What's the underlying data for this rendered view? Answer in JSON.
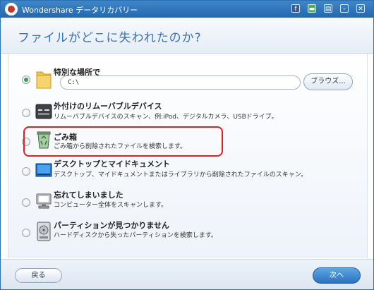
{
  "window": {
    "app_title": "Wondershare データリカバリー",
    "titlebar_icons": [
      "facebook-icon",
      "feedback-icon",
      "settings-icon",
      "minimize-icon",
      "close-icon"
    ]
  },
  "header": {
    "title": "ファイルがどこに失われたのか?"
  },
  "options": [
    {
      "title": "特別な場所で",
      "checked": true,
      "icon": "folder-icon",
      "path_value": "C:\\",
      "browse_label": "ブラウズ..."
    },
    {
      "title": "外付けのリムーバブルデバイス",
      "desc": "リムーバブルデバイスのスキャン、例:iPod、デジタルカメラ、USBドライブ。",
      "checked": false,
      "icon": "usb-device-icon"
    },
    {
      "title": "ごみ箱",
      "desc": "ごみ箱から削除されたファイルを検索します。",
      "checked": false,
      "icon": "recycle-bin-icon",
      "highlighted": true
    },
    {
      "title": "デスクトップとマイドキュメント",
      "desc": "デスクトップ、マイドキュメントまたはライブラリから削除されたファイルのスキャン。",
      "checked": false,
      "icon": "desktop-icon"
    },
    {
      "title": "忘れてしまいました",
      "desc": "コンピューター全体をスキャンします。",
      "checked": false,
      "icon": "computer-icon"
    },
    {
      "title": "パーティションが見つかりません",
      "desc": "ハードディスクから失ったパーティションを検索します。",
      "checked": false,
      "icon": "hard-disk-icon"
    }
  ],
  "footer": {
    "back_label": "戻る",
    "next_label": "次へ"
  },
  "colors": {
    "accent": "#2a6fb3",
    "title_text": "#3a73b4",
    "highlight": "#e02020",
    "radio_checked": "#3aa33a"
  }
}
